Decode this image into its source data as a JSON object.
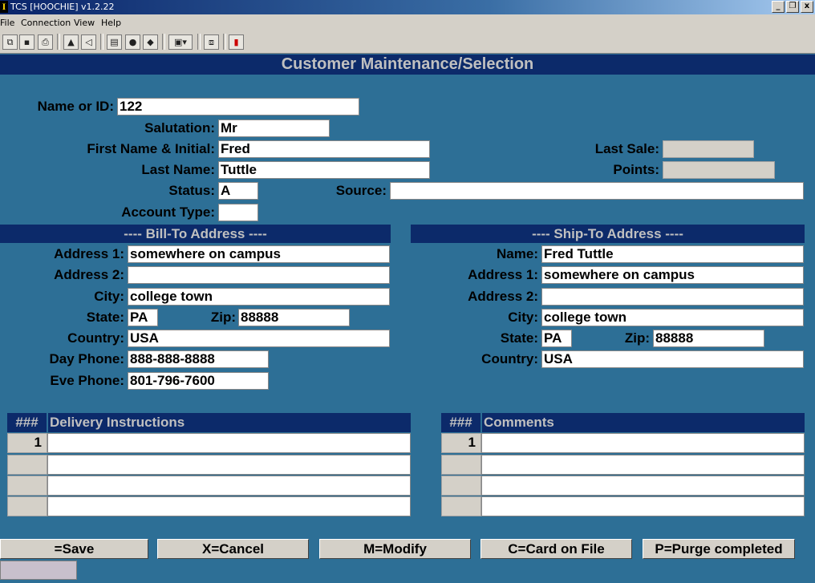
{
  "window": {
    "title": "TCS [HOOCHIE]  v1.2.22",
    "controls": [
      "_",
      "❐",
      "x"
    ]
  },
  "menu": [
    "File",
    "Connection",
    "View",
    "Help"
  ],
  "toolbar": {
    "icons": [
      "new-icon",
      "save-icon",
      "print-icon",
      "lock-icon",
      "audio-icon",
      "properties-icon",
      "monitor-icon",
      "book-icon",
      "window-dropdown-icon",
      "network-icon",
      "chart-icon"
    ]
  },
  "header": "Customer Maintenance/Selection",
  "form": {
    "name_or_id": {
      "label": "Name or ID:",
      "value": "122"
    },
    "salutation": {
      "label": "Salutation:",
      "value": "Mr"
    },
    "first_name": {
      "label": "First Name & Initial:",
      "value": "Fred"
    },
    "last_name": {
      "label": "Last Name:",
      "value": "Tuttle"
    },
    "status": {
      "label": "Status:",
      "value": "A"
    },
    "source": {
      "label": "Source:",
      "value": ""
    },
    "account_type": {
      "label": "Account Type:",
      "value": ""
    },
    "last_sale": {
      "label": "Last Sale:",
      "value": ""
    },
    "points": {
      "label": "Points:",
      "value": ""
    }
  },
  "bill_to": {
    "title": "---- Bill-To Address ----",
    "address1": {
      "label": "Address 1:",
      "value": "somewhere on campus"
    },
    "address2": {
      "label": "Address 2:",
      "value": ""
    },
    "city": {
      "label": "City:",
      "value": "college town"
    },
    "state": {
      "label": "State:",
      "value": "PA"
    },
    "zip": {
      "label": "Zip:",
      "value": "88888"
    },
    "country": {
      "label": "Country:",
      "value": "USA"
    },
    "day_phone": {
      "label": "Day Phone:",
      "value": "888-888-8888"
    },
    "eve_phone": {
      "label": "Eve Phone:",
      "value": "801-796-7600"
    }
  },
  "ship_to": {
    "title": "---- Ship-To Address ----",
    "name": {
      "label": "Name:",
      "value": "Fred Tuttle"
    },
    "address1": {
      "label": "Address 1:",
      "value": "somewhere on campus"
    },
    "address2": {
      "label": "Address 2:",
      "value": ""
    },
    "city": {
      "label": "City:",
      "value": "college town"
    },
    "state": {
      "label": "State:",
      "value": "PA"
    },
    "zip": {
      "label": "Zip:",
      "value": "88888"
    },
    "country": {
      "label": "Country:",
      "value": "USA"
    }
  },
  "delivery": {
    "num_header": "###",
    "title": "Delivery Instructions",
    "rows": [
      "1",
      "",
      "",
      ""
    ]
  },
  "comments": {
    "num_header": "###",
    "title": "Comments",
    "rows": [
      "1",
      "",
      "",
      ""
    ]
  },
  "buttons": {
    "save": "=Save",
    "cancel": "X=Cancel",
    "modify": "M=Modify",
    "card": "C=Card on File",
    "purge": "P=Purge completed"
  }
}
